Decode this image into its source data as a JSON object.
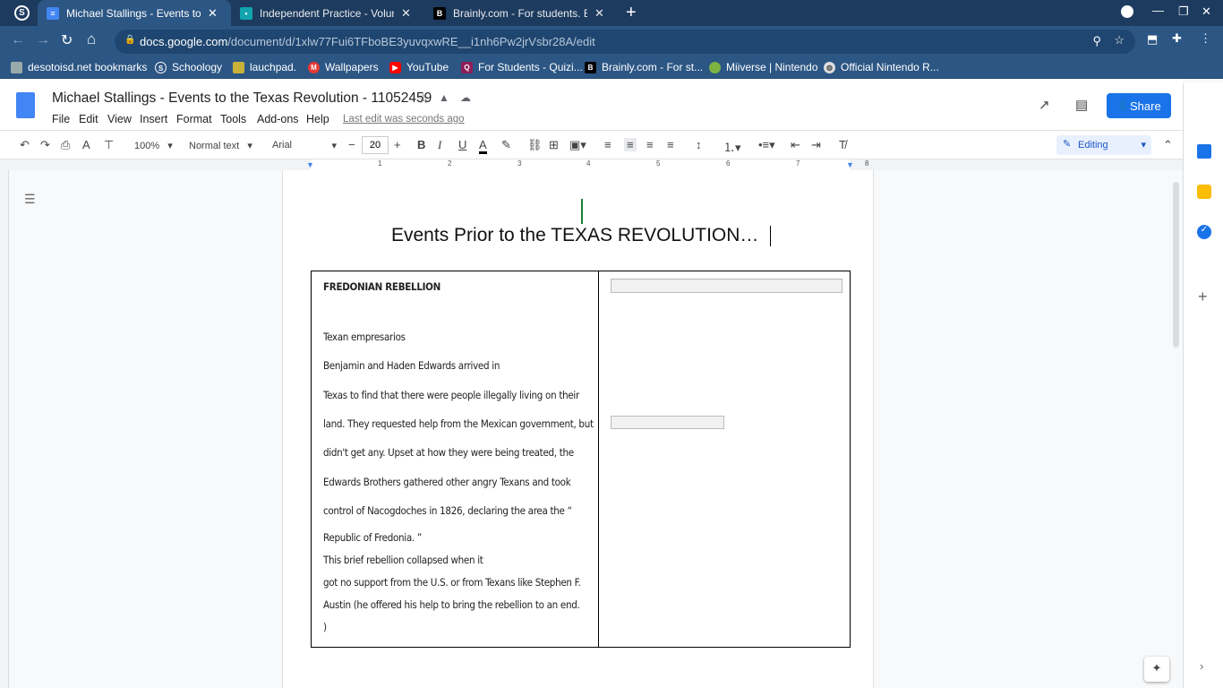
{
  "tabs": [
    {
      "title": "Michael Stallings - Events to the",
      "active": true,
      "color": "#4285f4"
    },
    {
      "title": "Independent Practice - Volume o",
      "active": false,
      "color": "#12a4af"
    },
    {
      "title": "Brainly.com - For students. By st",
      "active": false,
      "color": "#000000"
    }
  ],
  "url": {
    "host": "docs.google.com",
    "path": "/document/d/1xlw77Fui6TFboBE3yuvqxwRE__i1nh6Pw2jrVsbr28A/edit"
  },
  "bookmarks": [
    "desotoisd.net bookmarks",
    "Schoology",
    "lauchpad.",
    "Wallpapers",
    "YouTube",
    "For Students - Quizi...",
    "Brainly.com - For st...",
    "Miiverse | Nintendo",
    "Official Nintendo R..."
  ],
  "doc": {
    "title": "Michael Stallings - Events to the Texas Revolution - 11052459",
    "last_edit": "Last edit was seconds ago",
    "share": "Share"
  },
  "menu": [
    "File",
    "Edit",
    "View",
    "Insert",
    "Format",
    "Tools",
    "Add-ons",
    "Help"
  ],
  "toolbar": {
    "zoom": "100%",
    "style": "Normal text",
    "font": "Arial",
    "size": "20",
    "mode": "Editing"
  },
  "ruler": [
    "1",
    "2",
    "3",
    "4",
    "5",
    "6",
    "7",
    "8"
  ],
  "content": {
    "heading": "Events Prior to the TEXAS REVOLUTION…",
    "left_title": "FREDONIAN REBELLION",
    "lines": [
      "Texan empresarios",
      "Benjamin and Haden Edwards arrived in",
      "Texas to find that there were people illegally living on their",
      "land. They requested help from the Mexican government, but",
      "didn't get any. Upset at how they were being treated, the",
      "Edwards Brothers gathered other angry  Texans and took",
      "control of Nacogdoches in 1826, declaring the area the  “",
      "Republic of Fredonia.  ”",
      "This brief rebellion collapsed when it",
      "got no support from the U.S. or from Texans like Stephen F.",
      "Austin (he offered his help to bring the rebellion to an end.",
      ")"
    ]
  }
}
